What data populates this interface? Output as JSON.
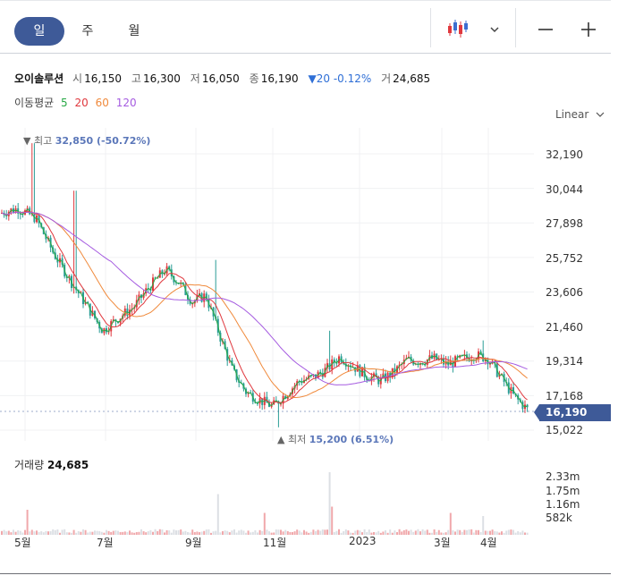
{
  "tabs": [
    {
      "label": "일"
    },
    {
      "label": "주"
    },
    {
      "label": "월"
    }
  ],
  "toolbar": {
    "chart_type_icon": "candlestick-icon",
    "minus_icon": "minus-icon",
    "plus_icon": "plus-icon"
  },
  "stock": {
    "name": "오이솔루션",
    "open_label": "시",
    "open": "16,150",
    "high_label": "고",
    "high": "16,300",
    "low_label": "저",
    "low": "16,050",
    "close_label": "종",
    "close": "16,190",
    "change": "▼20 -0.12%",
    "volume_label": "거",
    "volume": "24,685"
  },
  "ma": {
    "title": "이동평균",
    "p5": "5",
    "p20": "20",
    "p60": "60",
    "p120": "120"
  },
  "scale": "Linear",
  "high_marker": {
    "prefix": "▼ 최고",
    "value": "32,850 (-50.72%)"
  },
  "low_marker": {
    "prefix": "▲ 최저",
    "value": "15,200 (6.51%)"
  },
  "price_ticks": [
    "32,190",
    "30,044",
    "27,898",
    "25,752",
    "23,606",
    "21,460",
    "19,314",
    "17,168",
    "15,022"
  ],
  "current_price": "16,190",
  "volume": {
    "title": "거래량",
    "value": "24,685",
    "ticks": [
      "2.33m",
      "1.75m",
      "1.16m",
      "582k"
    ]
  },
  "x_ticks": [
    "5월",
    "7월",
    "9월",
    "11월",
    "2023",
    "3월",
    "4월"
  ],
  "colors": {
    "up": "#e0383e",
    "down": "#2a9d96",
    "ma5": "#27a844",
    "ma20": "#e0383e",
    "ma60": "#f08a3c",
    "ma120": "#a55be0",
    "accent": "#3e5a98"
  },
  "chart_data": {
    "type": "candlestick",
    "ylim": [
      15022,
      32190
    ],
    "anchors": [
      [
        0,
        28500
      ],
      [
        20,
        28800
      ],
      [
        40,
        28200
      ],
      [
        60,
        26000
      ],
      [
        80,
        24200
      ],
      [
        100,
        22500
      ],
      [
        115,
        21200
      ],
      [
        130,
        21900
      ],
      [
        150,
        22700
      ],
      [
        165,
        23800
      ],
      [
        185,
        25000
      ],
      [
        200,
        24200
      ],
      [
        215,
        23000
      ],
      [
        230,
        23400
      ],
      [
        245,
        21000
      ],
      [
        260,
        18700
      ],
      [
        275,
        17400
      ],
      [
        290,
        16900
      ],
      [
        305,
        16500
      ],
      [
        320,
        17300
      ],
      [
        335,
        18100
      ],
      [
        350,
        18300
      ],
      [
        365,
        18800
      ],
      [
        380,
        19600
      ],
      [
        395,
        19000
      ],
      [
        410,
        18400
      ],
      [
        425,
        18100
      ],
      [
        440,
        18600
      ],
      [
        455,
        19400
      ],
      [
        470,
        19300
      ],
      [
        485,
        19500
      ],
      [
        500,
        19100
      ],
      [
        515,
        19400
      ],
      [
        530,
        19700
      ],
      [
        545,
        19500
      ],
      [
        560,
        18300
      ],
      [
        575,
        17100
      ],
      [
        592,
        16190
      ]
    ],
    "spikes": [
      {
        "i": 37,
        "h": 32850
      },
      {
        "i": 84,
        "h": 29900
      },
      {
        "i": 242,
        "h": 25600
      },
      {
        "i": 311,
        "h": 15200
      },
      {
        "i": 368,
        "h": 21200
      },
      {
        "i": 540,
        "h": 20600
      }
    ],
    "ma_last": {
      "ma5": 16400,
      "ma20": 17700,
      "ma60": 18900,
      "ma120": 18700
    },
    "volume_max": 2330000,
    "volume_spikes": [
      {
        "i": 30,
        "v": 0.4
      },
      {
        "i": 243,
        "v": 0.65
      },
      {
        "i": 295,
        "v": 0.35
      },
      {
        "i": 368,
        "v": 1.0
      },
      {
        "i": 372,
        "v": 0.45
      },
      {
        "i": 504,
        "v": 0.35
      },
      {
        "i": 540,
        "v": 0.3
      }
    ]
  }
}
